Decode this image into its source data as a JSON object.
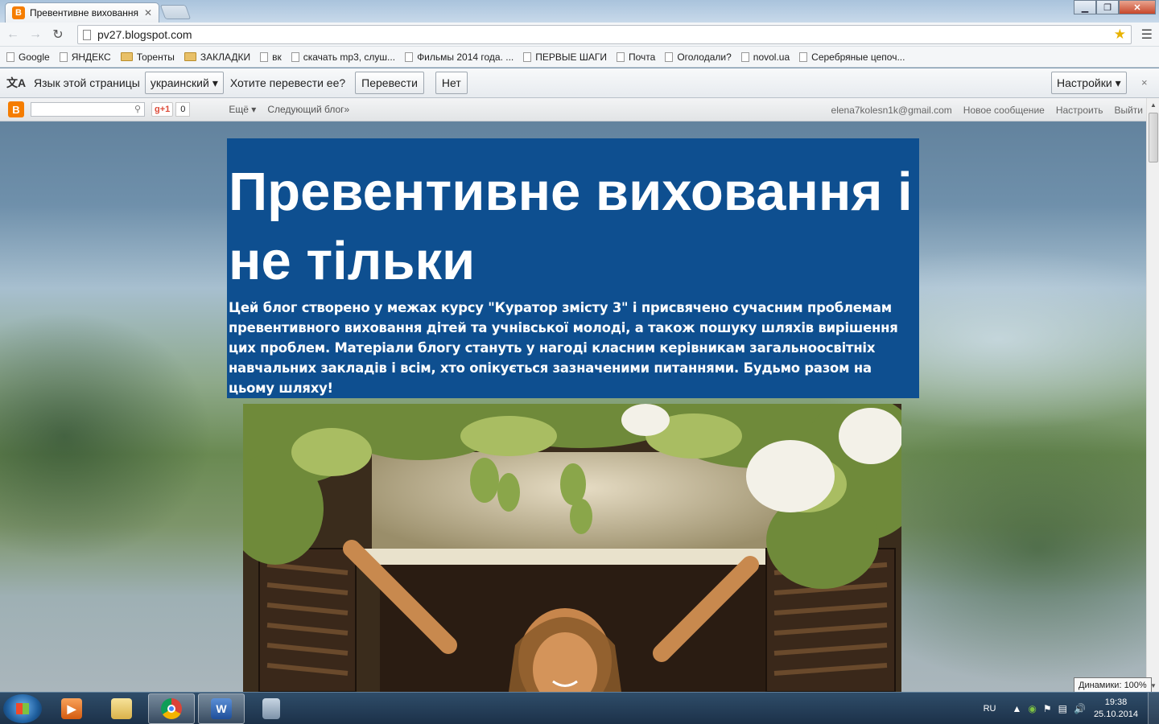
{
  "tab": {
    "title": "Превентивне виховання і",
    "favicon_letter": "B",
    "close_icon": "✕"
  },
  "window": {
    "minimize": "▁",
    "maximize": "❐",
    "close": "✕"
  },
  "address": {
    "url": "pv27.blogspot.com"
  },
  "bookmarks": [
    {
      "label": "Google",
      "type": "page"
    },
    {
      "label": "ЯНДЕКС",
      "type": "page"
    },
    {
      "label": "Торенты",
      "type": "folder"
    },
    {
      "label": "ЗАКЛАДКИ",
      "type": "folder"
    },
    {
      "label": "вк",
      "type": "page"
    },
    {
      "label": "скачать mp3, слуш...",
      "type": "page"
    },
    {
      "label": "Фильмы 2014 года. ...",
      "type": "page"
    },
    {
      "label": "ПЕРВЫЕ ШАГИ",
      "type": "page"
    },
    {
      "label": "Почта",
      "type": "page"
    },
    {
      "label": "Оголодали?",
      "type": "page"
    },
    {
      "label": "novol.ua",
      "type": "page"
    },
    {
      "label": "Серебряные цепоч...",
      "type": "page"
    }
  ],
  "translate": {
    "language_prompt": "Язык этой страницы",
    "language": "украинский",
    "question": "Хотите перевести ее?",
    "translate_button": "Перевести",
    "no_button": "Нет",
    "settings_button": "Настройки",
    "close": "×"
  },
  "blogger_bar": {
    "logo_letter": "B",
    "gplus": "g+1",
    "gplus_count": "0",
    "more": "Ещё",
    "next_blog": "Следующий блог»",
    "email": "elena7kolesn1k@gmail.com",
    "new_post": "Новое сообщение",
    "customize": "Настроить",
    "sign_out": "Выйти"
  },
  "blog": {
    "title": "Превентивне виховання і не тільки",
    "description": "Цей блог створено у межах курсу \"Куратор змісту 3\" і присвячено сучасним проблемам превентивного виховання дітей та учнівської молоді, а також пошуку шляхів вирішення цих проблем. Матеріали блогу стануть у нагоді класним керівникам загальноосвітніх навчальних закладів і всім, хто опікується зазначеними питаннями. Будьмо разом на цьому шляху!"
  },
  "taskbar": {
    "word_letter": "W",
    "lang": "RU",
    "time": "19:38",
    "date": "25.10.2014",
    "volume_tooltip": "Динамики: 100%"
  },
  "colors": {
    "header_bg": "#0e4f90",
    "blogger_orange": "#f57d00"
  }
}
